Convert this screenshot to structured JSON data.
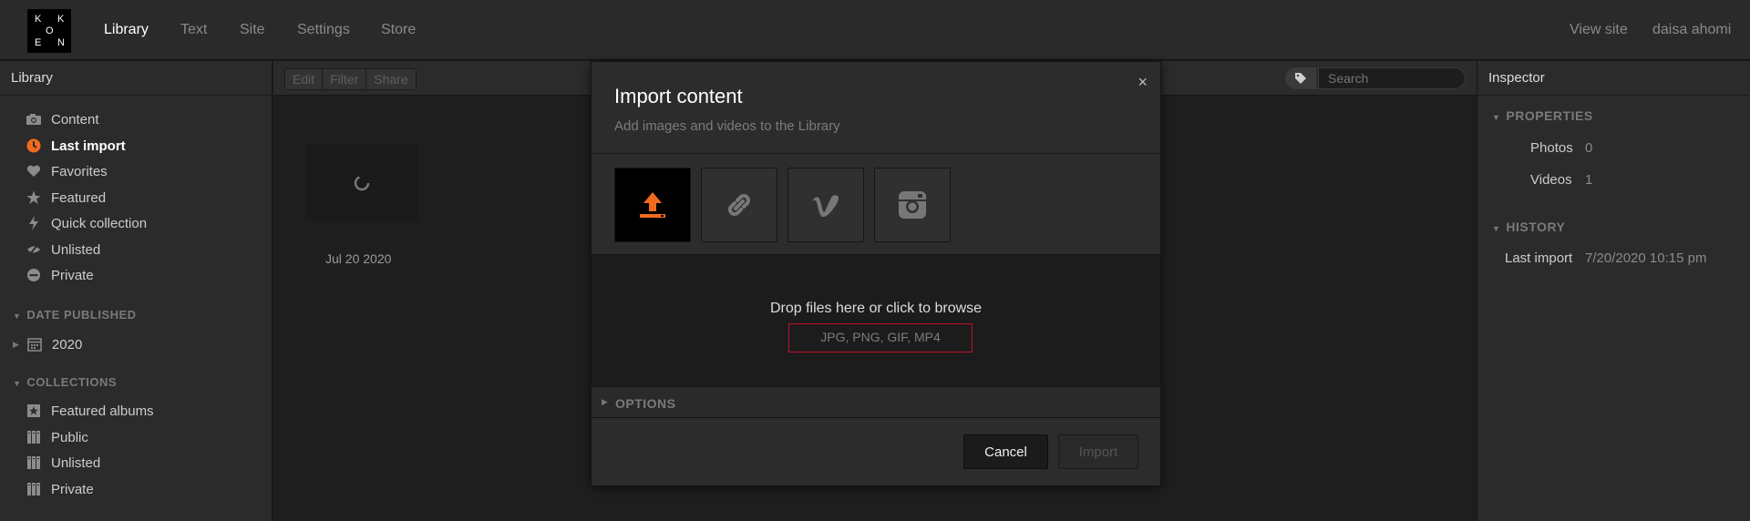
{
  "topbar": {
    "logo_letters": [
      "K",
      "K",
      "O",
      "E",
      "N"
    ],
    "nav": [
      "Library",
      "Text",
      "Site",
      "Settings",
      "Store"
    ],
    "active_nav": "Library",
    "view_site": "View site",
    "user": "daisa ahomi"
  },
  "library": {
    "header": "Library",
    "items": [
      {
        "label": "Content",
        "icon": "camera-icon"
      },
      {
        "label": "Last import",
        "icon": "clock-icon"
      },
      {
        "label": "Favorites",
        "icon": "heart-icon"
      },
      {
        "label": "Featured",
        "icon": "star-icon"
      },
      {
        "label": "Quick collection",
        "icon": "lightning-icon"
      },
      {
        "label": "Unlisted",
        "icon": "eye-slash-icon"
      },
      {
        "label": "Private",
        "icon": "minus-circle-icon"
      }
    ],
    "date_section": "DATE PUBLISHED",
    "date_items": [
      {
        "label": "2020",
        "icon": "calendar-icon"
      }
    ],
    "collections_section": "COLLECTIONS",
    "collections": [
      {
        "label": "Featured albums",
        "icon": "star-album-icon"
      },
      {
        "label": "Public",
        "icon": "album-icon"
      },
      {
        "label": "Unlisted",
        "icon": "album-icon"
      },
      {
        "label": "Private",
        "icon": "album-icon"
      }
    ]
  },
  "toolbar": {
    "edit": "Edit",
    "filter": "Filter",
    "share": "Share",
    "search_placeholder": "Search"
  },
  "content": {
    "thumb_date": "Jul 20 2020"
  },
  "inspector": {
    "header": "Inspector",
    "properties_label": "PROPERTIES",
    "photos_label": "Photos",
    "photos_value": "0",
    "videos_label": "Videos",
    "videos_value": "1",
    "history_label": "HISTORY",
    "last_import_label": "Last import",
    "last_import_value": "7/20/2020 10:15 pm"
  },
  "modal": {
    "title": "Import content",
    "subtitle": "Add images and videos to the Library",
    "close": "×",
    "sources": [
      "upload-icon",
      "link-icon",
      "vimeo-icon",
      "instagram-icon"
    ],
    "drop_title": "Drop files here or click to browse",
    "drop_types": "JPG, PNG, GIF, MP4",
    "options_label": "OPTIONS",
    "cancel": "Cancel",
    "import": "Import"
  },
  "colors": {
    "accent": "#f26b1d",
    "highlight_border": "#c0122c"
  }
}
